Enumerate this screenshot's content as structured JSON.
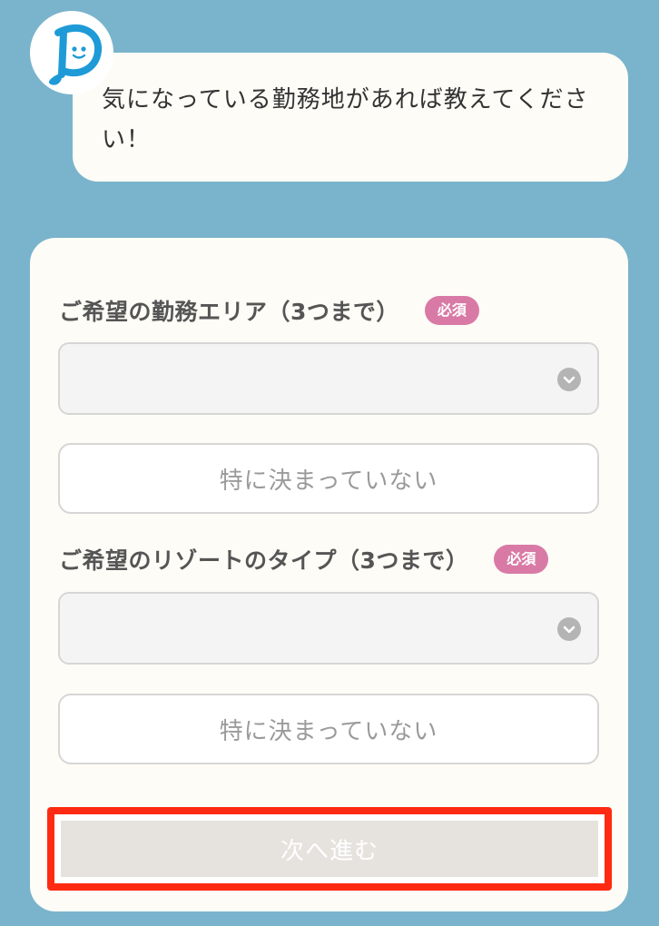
{
  "assistant": {
    "avatar_icon": "mascot-logo-icon",
    "message": "気になっている勤務地があれば教えてください！"
  },
  "form": {
    "area": {
      "label": "ご希望の勤務エリア（3つまで）",
      "required_badge": "必須",
      "selected_value": "",
      "no_preference_label": "特に決まっていない"
    },
    "resort_type": {
      "label": "ご希望のリゾートのタイプ（3つまで）",
      "required_badge": "必須",
      "selected_value": "",
      "no_preference_label": "特に決まっていない"
    },
    "next_label": "次へ進む"
  },
  "colors": {
    "background": "#7ab4cc",
    "card": "#fdfcf6",
    "required_badge": "#d97aa6",
    "highlight_border": "#ff2a12",
    "next_button_disabled": "#e6e3df",
    "logo_blue": "#1e9bd7"
  }
}
